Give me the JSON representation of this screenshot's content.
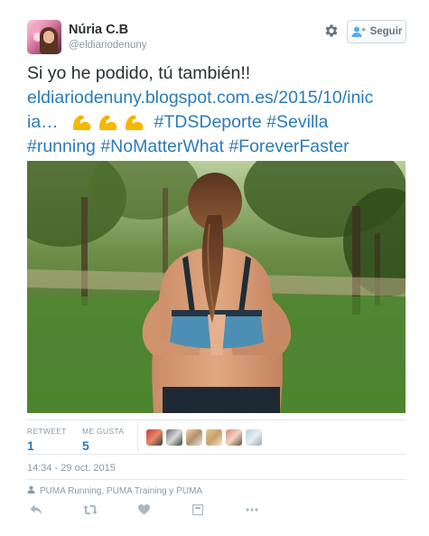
{
  "user": {
    "name": "Núria C.B",
    "handle": "@eldiariodenuny"
  },
  "header": {
    "follow_label": "Seguir",
    "follow_icon": "person-plus-icon",
    "settings_icon": "gear-icon"
  },
  "tweet": {
    "line1": "Si yo he podido, tú también!!",
    "link_part1": "eldiariodenuny.blogspot.com.es/2015/10/inic",
    "link_part2": "ia…",
    "emoji_name": "flexed-biceps",
    "emoji_count": 3,
    "hashtags": [
      "#TDSDeporte",
      "#Sevilla",
      "#running",
      "#NoMatterWhat",
      "#ForeverFaster"
    ]
  },
  "stats": {
    "retweet_label": "RETWEET",
    "retweet_count": "1",
    "likes_label": "ME GUSTA",
    "likes_count": "5",
    "liker_avatars": 6
  },
  "timestamp": "14:34 - 29 oct. 2015",
  "context": "PUMA Running, PUMA Training y PUMA",
  "actions": [
    "reply-icon",
    "retweet-icon",
    "like-icon",
    "share-icon",
    "more-icon"
  ],
  "colors": {
    "link": "#2b7bb9",
    "muted": "#8899a6",
    "text": "#292f33",
    "border": "#e1e8ed"
  }
}
